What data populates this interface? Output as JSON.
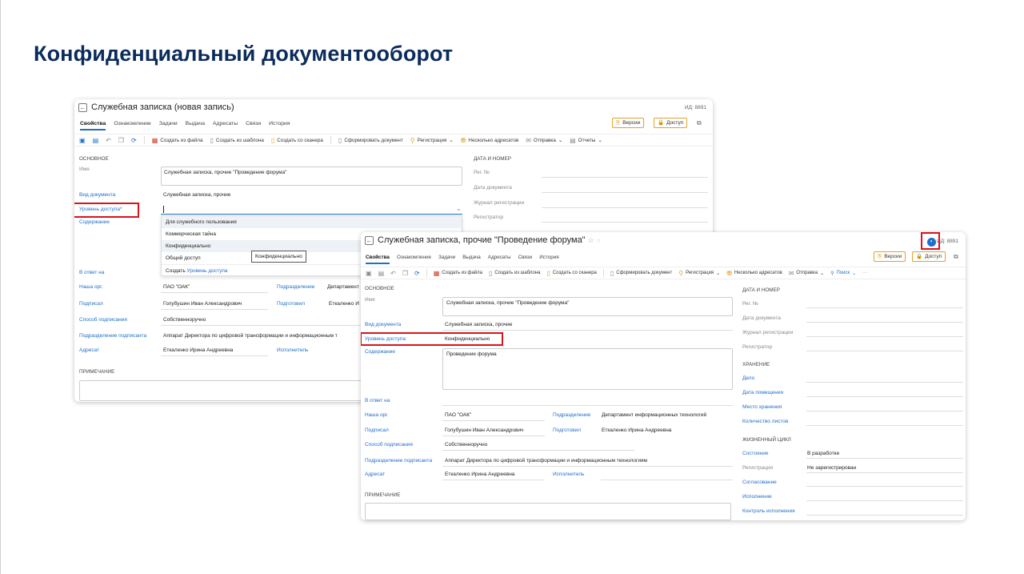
{
  "slide": {
    "title": "Конфиденциальный документооборот"
  },
  "card1": {
    "title": "Служебная записка (новая запись)",
    "id_label": "ИД: 8891",
    "tabs": [
      "Свойства",
      "Ознакомление",
      "Задачи",
      "Выдача",
      "Адресаты",
      "Связи",
      "История"
    ],
    "btn_versions": "Версии",
    "btn_access": "Доступ",
    "toolbar": [
      "Создать из файла",
      "Создать из шаблона",
      "Создать со сканера",
      "Сформировать документ",
      "Регистрация",
      "Несколько адресатов",
      "Отправка",
      "Отчеты"
    ],
    "section_main": "ОСНОВНОЕ",
    "section_date": "ДАТА И НОМЕР",
    "section_note": "ПРИМЕЧАНИЕ",
    "labels": {
      "name": "Имя",
      "doc_type": "Вид документа",
      "access_level": "Уровень доступа",
      "access_star": "*",
      "content": "Содержание",
      "reply_to": "В ответ на",
      "our_org": "Наша орг.",
      "signed": "Подписал",
      "sign_method": "Способ подписания",
      "sign_dept": "Подразделение подписанта",
      "addressee": "Адресат",
      "dept": "Подразделение",
      "prepared": "Подготовил",
      "executor": "Исполнитель",
      "reg_no": "Рег. №",
      "doc_date": "Дата документа",
      "reg_journal": "Журнал регистрации",
      "registrar": "Регистратор"
    },
    "values": {
      "name": "Служебная записка, прочие \"Проведение форума\"",
      "doc_type": "Служебная записка, прочие",
      "our_org": "ПАО \"ОАК\"",
      "dept": "Департамент",
      "signed": "Голубушин Иван Александрович",
      "prepared": "Еткаленко И",
      "sign_method": "Собственноручно",
      "sign_dept": "Аппарат Директора по цифровой трансформации и информационным т",
      "addressee": "Еткаленко Ирина Андреевна"
    },
    "dropdown": {
      "items": [
        "Для служебного пользования",
        "Коммерческая тайна",
        "Конфиденциально",
        "Общий доступ"
      ],
      "create_prefix": "Создать ",
      "create_link": "Уровень доступа",
      "tooltip": "Конфиденциально"
    }
  },
  "card2": {
    "title": "Служебная записка, прочие \"Проведение форума\"",
    "star": "☆",
    "id_label": "ИД: 8891",
    "tabs": [
      "Свойства",
      "Ознакомление",
      "Задачи",
      "Выдача",
      "Адресаты",
      "Связи",
      "История"
    ],
    "btn_versions": "Версии",
    "btn_access": "Доступ",
    "toolbar": [
      "Создать из файла",
      "Создать из шаблона",
      "Создать со сканера",
      "Сформировать документ",
      "Регистрация",
      "Несколько адресатов",
      "Отправка",
      "Поиск",
      "···"
    ],
    "section_main": "ОСНОВНОЕ",
    "section_date": "ДАТА И НОМЕР",
    "section_storage": "ХРАНЕНИЕ",
    "section_life": "ЖИЗНЕННЫЙ ЦИКЛ",
    "section_note": "ПРИМЕЧАНИЕ",
    "labels": {
      "name": "Имя",
      "doc_type": "Вид документа",
      "access_level": "Уровень доступа",
      "content": "Содержание",
      "reply_to": "В ответ на",
      "our_org": "Наша орг.",
      "signed": "Подписал",
      "sign_method": "Способ подписания",
      "sign_dept": "Подразделение подписанта",
      "addressee": "Адресат",
      "dept": "Подразделение",
      "prepared": "Подготовил",
      "executor": "Исполнитель",
      "reg_no": "Рег. №",
      "doc_date": "Дата документа",
      "reg_journal": "Журнал регистрации",
      "registrar": "Регистратор",
      "case": "Дело",
      "placed_date": "Дата помещения",
      "storage_place": "Место хранения",
      "sheets": "Количество листов",
      "state": "Состояние",
      "registration": "Регистрация",
      "approval": "Согласование",
      "execution": "Исполнение",
      "exec_control": "Контроль исполнения"
    },
    "values": {
      "name": "Служебная записка, прочие \"Проведение форума\"",
      "doc_type": "Служебная записка, прочие",
      "access_level": "Конфиденциально",
      "content": "Проведение форума",
      "our_org": "ПАО \"ОАК\"",
      "dept": "Департамент информационных технологий",
      "signed": "Голубушин Иван Александрович",
      "prepared": "Еткаленко Ирина Андреевна",
      "sign_method": "Собственноручно",
      "sign_dept": "Аппарат Директора по цифровой трансформации и информационным технологиям",
      "addressee": "Еткаленко Ирина Андреевна",
      "state": "В разработке",
      "registration": "Не зарегистрирован"
    }
  },
  "colors": {
    "title": "#0b2b5c",
    "link": "#1f6fc9",
    "highlight": "#d8141a",
    "accent_btn": "#e0a32a"
  }
}
